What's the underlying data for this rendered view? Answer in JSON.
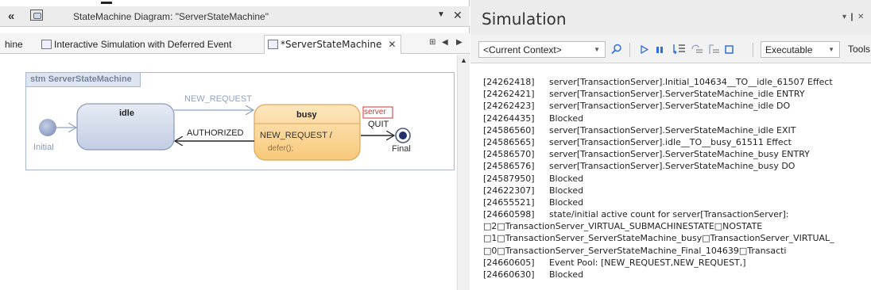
{
  "left_panel": {
    "window_title": "StateMachine Diagram: \"ServerStateMachine\"",
    "tabs": [
      {
        "label": "hine"
      },
      {
        "label": "Interactive Simulation with Deferred Event"
      },
      {
        "label": "*ServerStateMachine"
      }
    ],
    "diagram": {
      "frame_label": "stm ServerStateMachine",
      "initial_label": "Initial",
      "final_label": "Final",
      "states": {
        "idle": {
          "name": "idle"
        },
        "busy": {
          "name": "busy",
          "internal": "NEW_REQUEST /",
          "action": "defer();"
        }
      },
      "transitions": {
        "new_request": "NEW_REQUEST",
        "authorized": "AUTHORIZED",
        "quit": "QUIT",
        "partition": "server"
      }
    }
  },
  "right_panel": {
    "title": "Simulation",
    "header_icons": "▾  ❙  ✕",
    "toolbar": {
      "context": "<Current Context>",
      "mode": "Executable",
      "tools": "Tools"
    },
    "log": [
      {
        "ts": "[24262418]",
        "msg": "server[TransactionServer].Initial_104634__TO__idle_61507 Effect"
      },
      {
        "ts": "[24262421]",
        "msg": "server[TransactionServer].ServerStateMachine_idle ENTRY"
      },
      {
        "ts": "[24262423]",
        "msg": "server[TransactionServer].ServerStateMachine_idle DO"
      },
      {
        "ts": "[24264435]",
        "msg": "Blocked"
      },
      {
        "ts": "[24586560]",
        "msg": "server[TransactionServer].ServerStateMachine_idle EXIT"
      },
      {
        "ts": "[24586565]",
        "msg": "server[TransactionServer].idle__TO__busy_61511 Effect"
      },
      {
        "ts": "[24586570]",
        "msg": "server[TransactionServer].ServerStateMachine_busy ENTRY"
      },
      {
        "ts": "[24586576]",
        "msg": "server[TransactionServer].ServerStateMachine_busy DO"
      },
      {
        "ts": "[24587950]",
        "msg": "Blocked"
      },
      {
        "ts": "[24622307]",
        "msg": "Blocked"
      },
      {
        "ts": "[24655521]",
        "msg": "Blocked"
      },
      {
        "ts": "[24660598]",
        "msg": "state/initial active count for server[TransactionServer]:"
      },
      {
        "ts": "",
        "msg": "□2□TransactionServer_VIRTUAL_SUBMACHINESTATE□NOSTATE"
      },
      {
        "ts": "",
        "msg": "□1□TransactionServer_ServerStateMachine_busy□TransactionServer_VIRTUAL_"
      },
      {
        "ts": "",
        "msg": "□0□TransactionServer_ServerStateMachine_Final_104639□Transacti"
      },
      {
        "ts": "[24660605]",
        "msg": "Event Pool: [NEW_REQUEST,NEW_REQUEST,]"
      },
      {
        "ts": "[24660630]",
        "msg": "Blocked"
      }
    ]
  },
  "colors": {
    "state_idle_fill": "#d2daea",
    "state_busy_fill": "#fcd89c",
    "frame_border": "#a9b6cf",
    "toolbar_blue": "#2f6fd6"
  }
}
